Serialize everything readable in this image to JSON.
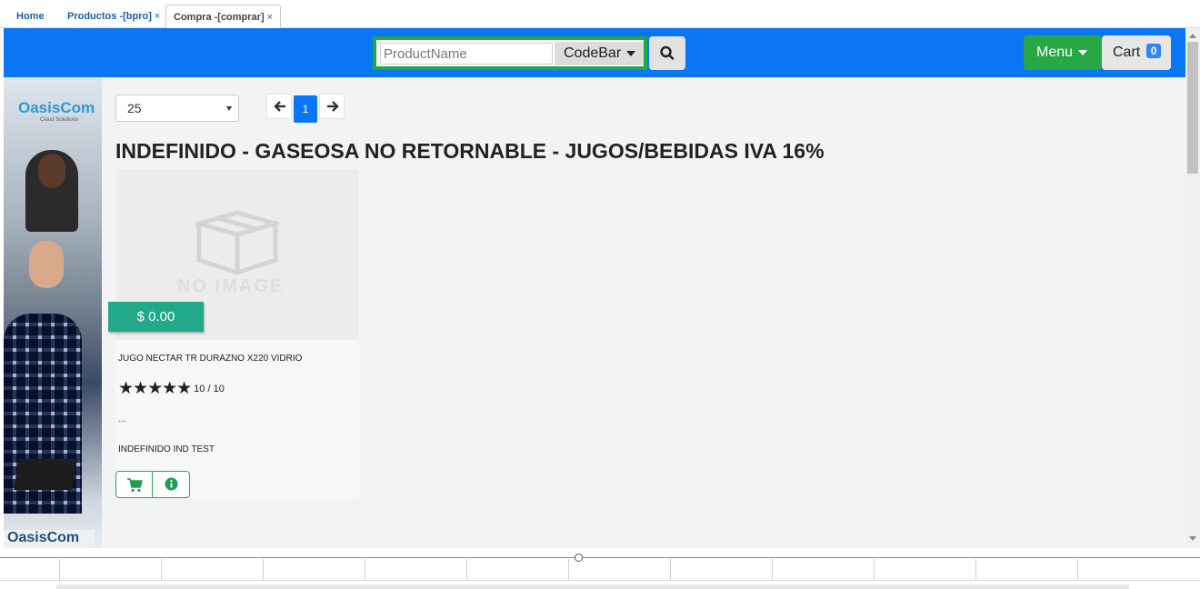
{
  "tabs": [
    {
      "label": "Home",
      "closable": false
    },
    {
      "label": "Productos -[bpro]",
      "closable": true
    },
    {
      "label": "Compra -[comprar]",
      "closable": true,
      "active": true
    }
  ],
  "tab_close_glyph": "×",
  "navbar": {
    "search_placeholder": "ProductName",
    "search_mode_label": "CodeBar",
    "search_icon": "search-icon",
    "menu_label": "Menu",
    "cart_label": "Cart",
    "cart_count": "0",
    "background_color": "#0a76f6"
  },
  "side_banner": {
    "logo_text": "OasisCom",
    "logo_sub": "Cloud Solutions",
    "logo_text_bottom": "OasisCom"
  },
  "page_size_select": {
    "value": "25"
  },
  "pagination": {
    "current_page": "1",
    "prev_icon": "arrow-left-icon",
    "next_icon": "arrow-right-icon"
  },
  "category_heading": "INDEFINIDO - GASEOSA NO RETORNABLE - JUGOS/BEBIDAS IVA 16%",
  "products": [
    {
      "image_placeholder_text": "NO IMAGE",
      "price": "$ 0.00",
      "name": "JUGO NECTAR TR DURAZNO X220 VIDRIO",
      "stars": "★★★★★",
      "rating_text": "10 / 10",
      "description": "...",
      "brand_line": "INDEFINIDO IND TEST",
      "actions": [
        "cart-icon",
        "info-icon"
      ]
    }
  ],
  "colors": {
    "accent_green": "#28a745",
    "price_green": "#21a98a",
    "highlight_border": "#1eac3c"
  }
}
